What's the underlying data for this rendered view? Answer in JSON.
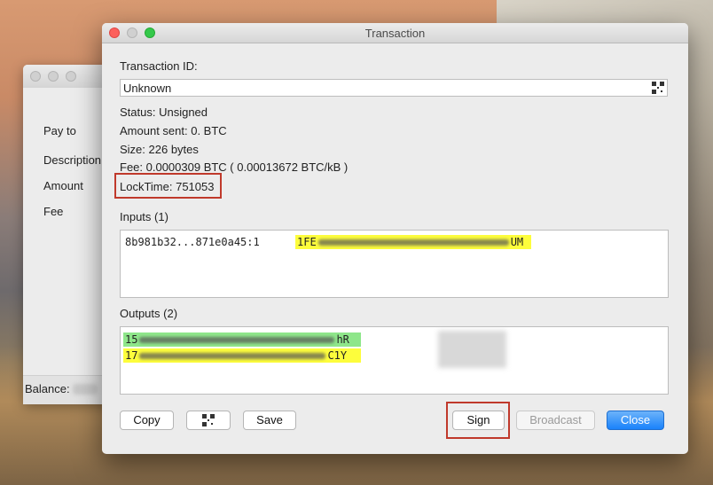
{
  "background_window": {
    "labels": [
      "Pay to",
      "Description",
      "Amount",
      "Fee"
    ],
    "balance_label": "Balance:"
  },
  "dialog": {
    "title": "Transaction",
    "txid_label": "Transaction ID:",
    "txid_value": "Unknown",
    "status": "Status: Unsigned",
    "amount_sent": "Amount sent: 0. BTC",
    "size": "Size: 226 bytes",
    "fee": "Fee: 0.0000309 BTC  ( 0.00013672 BTC/kB )",
    "locktime": "LockTime: 751053",
    "inputs_label": "Inputs (1)",
    "inputs": [
      {
        "outpoint": "8b981b32...871e0a45:1",
        "address_start": "1FE",
        "address_end": "UM"
      }
    ],
    "outputs_label": "Outputs (2)",
    "outputs": [
      {
        "address_start": "15",
        "address_end": "hR",
        "color": "green"
      },
      {
        "address_start": "17",
        "address_end": "C1Y",
        "color": "yellow"
      }
    ],
    "buttons": {
      "copy": "Copy",
      "save": "Save",
      "sign": "Sign",
      "broadcast": "Broadcast",
      "close": "Close"
    }
  },
  "colors": {
    "highlight": "#c0392b",
    "address_yellow": "#fdfd3c",
    "address_green": "#8ee68a",
    "primary_button": "#1a82fb"
  }
}
